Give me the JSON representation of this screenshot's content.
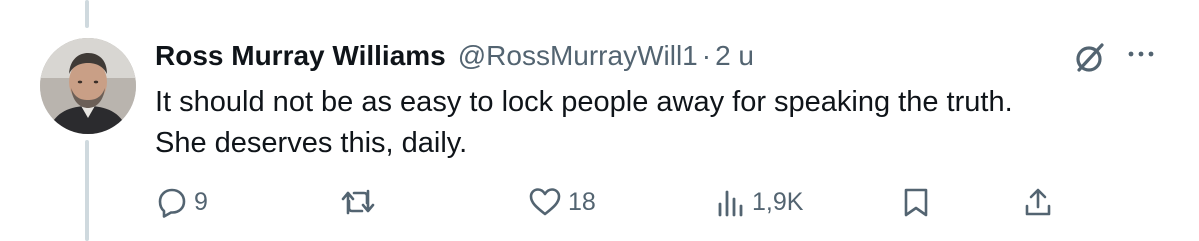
{
  "tweet": {
    "author_name": "Ross Murray Williams",
    "author_handle": "@RossMurrayWill1",
    "separator": "·",
    "time": "2 u",
    "text_lines": [
      "It should not be as easy to lock people away for speaking the truth.",
      "She deserves this, daily."
    ]
  },
  "actions": {
    "reply_count": "9",
    "repost_count": "",
    "like_count": "18",
    "views_count": "1,9K"
  },
  "icons": [
    "avatar-photo",
    "grok-icon",
    "more-icon",
    "reply-icon",
    "repost-icon",
    "like-icon",
    "views-icon",
    "bookmark-icon",
    "share-icon"
  ],
  "colors": {
    "text_primary": "#0f1419",
    "text_secondary": "#536471",
    "thread_line": "#cfd9de",
    "background": "#ffffff"
  }
}
